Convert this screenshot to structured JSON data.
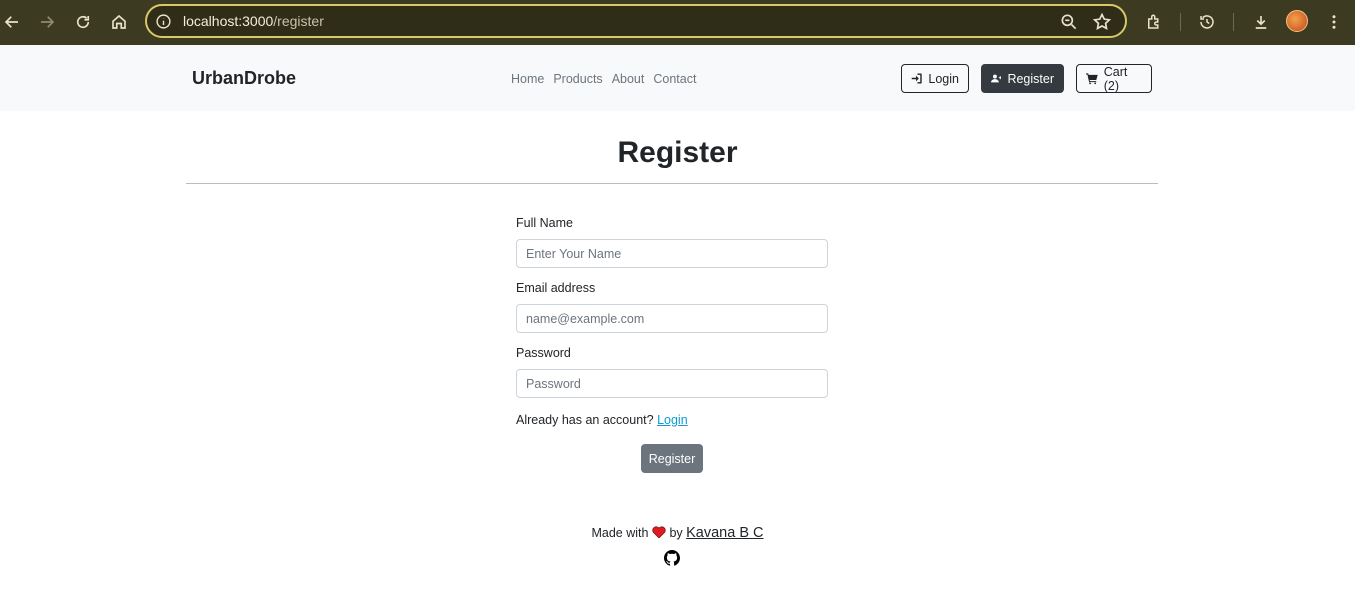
{
  "browser": {
    "url_host": "localhost:3000",
    "url_path": "/register"
  },
  "navbar": {
    "brand": "UrbanDrobe",
    "links": [
      "Home",
      "Products",
      "About",
      "Contact"
    ],
    "login_label": "Login",
    "register_label": "Register",
    "cart_label": "Cart (2)"
  },
  "page": {
    "title": "Register"
  },
  "form": {
    "name_label": "Full Name",
    "name_placeholder": "Enter Your Name",
    "email_label": "Email address",
    "email_placeholder": "name@example.com",
    "password_label": "Password",
    "password_placeholder": "Password",
    "already_text": "Already has an account?",
    "login_link": "Login",
    "submit_label": "Register"
  },
  "footer": {
    "made_with": "Made with",
    "by": "by",
    "author": "Kavana B C"
  },
  "colors": {
    "chrome_bg": "#3d3a22",
    "omnibox_border": "#d8c869",
    "navbar_bg": "#f8f9fa",
    "dark_button": "#343a40",
    "submit_button": "#6c757d",
    "link": "#0d9bd1",
    "heart": "#e01b24"
  }
}
